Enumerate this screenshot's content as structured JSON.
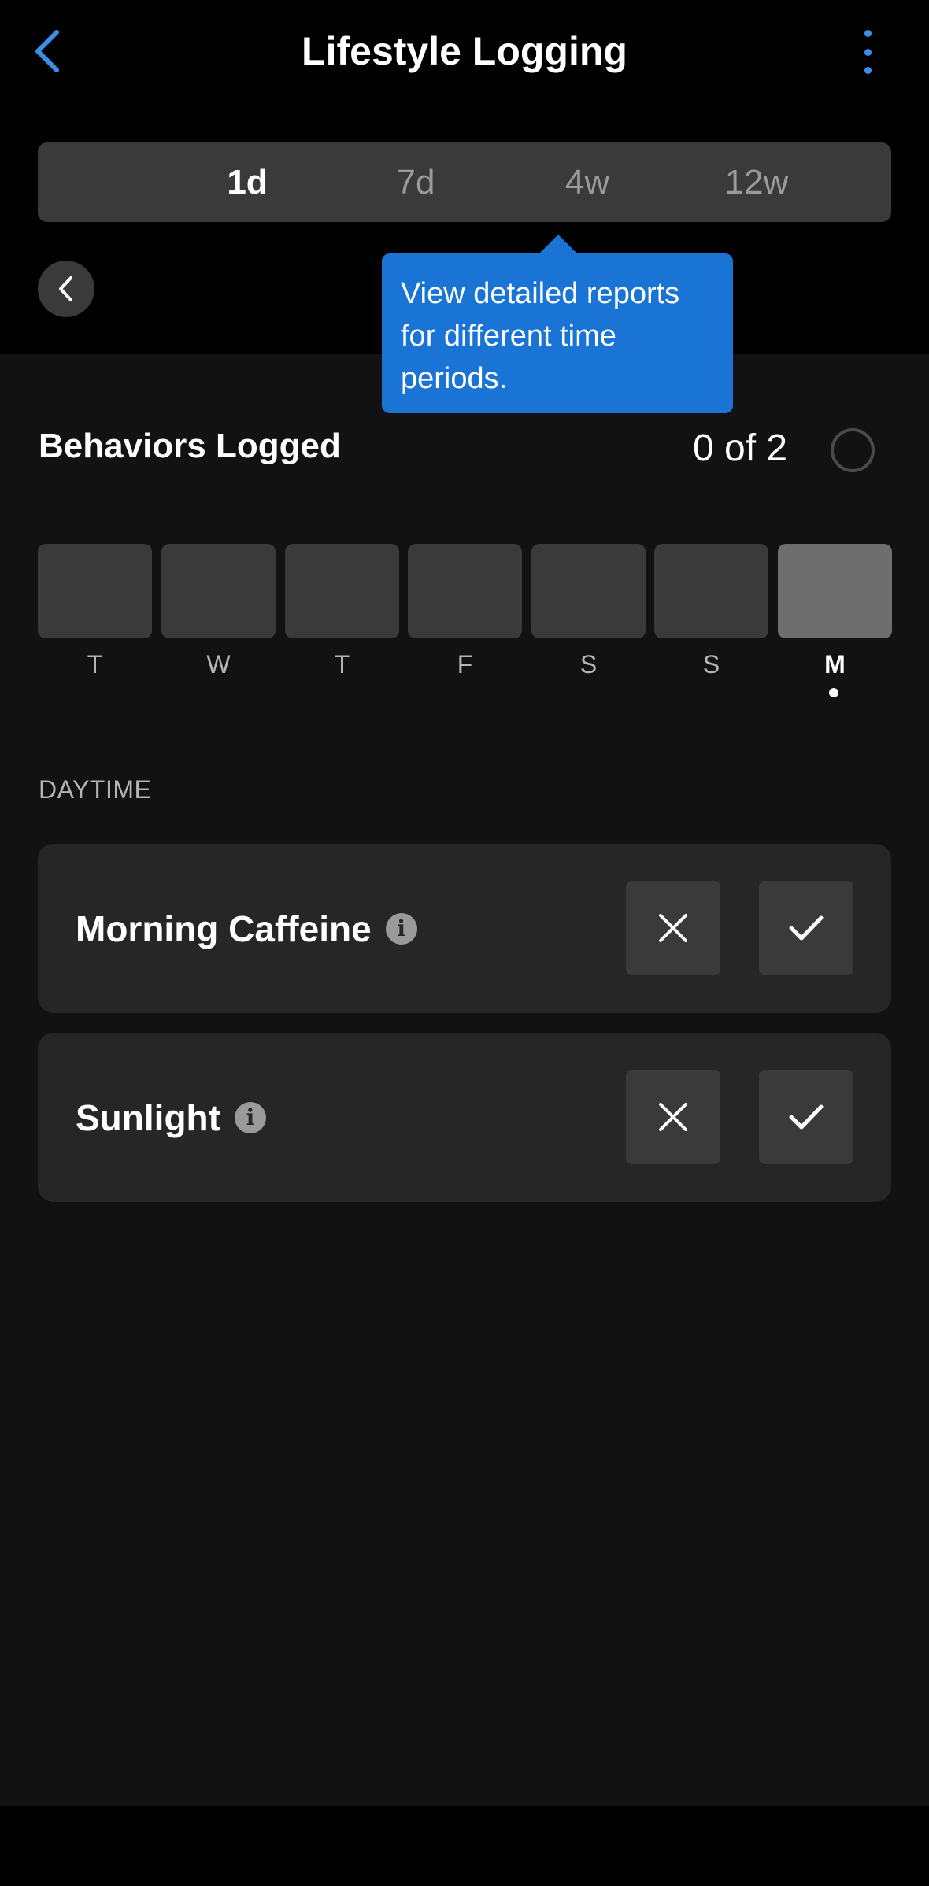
{
  "header": {
    "title": "Lifestyle Logging",
    "back_icon": "chevron-left-icon",
    "more_icon": "vertical-ellipsis-icon"
  },
  "range_tabs": [
    {
      "label": "1d",
      "active": true
    },
    {
      "label": "7d",
      "active": false
    },
    {
      "label": "4w",
      "active": false
    },
    {
      "label": "12w",
      "active": false
    }
  ],
  "tooltip": {
    "text": "View detailed reports for different time periods."
  },
  "behaviors": {
    "title": "Behaviors Logged",
    "count": "0 of 2"
  },
  "days": [
    {
      "label": "T",
      "today": false
    },
    {
      "label": "W",
      "today": false
    },
    {
      "label": "T",
      "today": false
    },
    {
      "label": "F",
      "today": false
    },
    {
      "label": "S",
      "today": false
    },
    {
      "label": "S",
      "today": false
    },
    {
      "label": "M",
      "today": true
    }
  ],
  "section": {
    "label": "DAYTIME"
  },
  "items": [
    {
      "label": "Morning Caffeine",
      "info_icon": "info-icon"
    },
    {
      "label": "Sunlight",
      "info_icon": "info-icon"
    }
  ],
  "colors": {
    "accent": "#3b8de8",
    "tooltip": "#1a74d6",
    "background": "#121212",
    "card": "#262626"
  }
}
